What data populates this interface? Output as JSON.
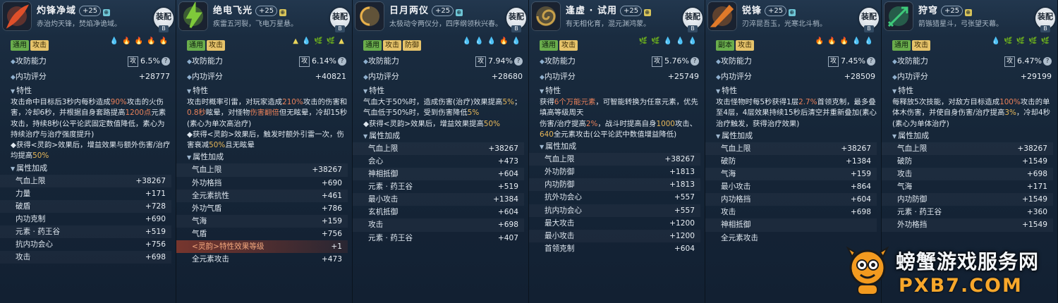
{
  "labels": {
    "equip": "装配",
    "equip_badge": "B",
    "attack_power": "攻防能力",
    "attack_box": "攻",
    "help": "?",
    "inner_score": "内功评分",
    "traits": "特性",
    "attr_bonus": "属性加成"
  },
  "cards": [
    {
      "name": "灼锋净域",
      "level": "+25",
      "gem": "⊕",
      "subtitle": "赤治灼天锋，焚焰净诡域。",
      "icon": "flame-slash-icon",
      "icon_color": "#e0502a",
      "tags": [
        "通用",
        "攻击"
      ],
      "tag_colors": [
        "green",
        "yellow"
      ],
      "elements": [
        "💧",
        "🔥",
        "🔥",
        "🔥",
        "🔥"
      ],
      "element_colors": [
        "#6fb3ff",
        "#ff6a3d",
        "#ff6a3d",
        "#ff6a3d",
        "#ff6a3d"
      ],
      "power": "6.5%",
      "score": "+28777",
      "desc": [
        {
          "t": "攻击命中目标后3秒内每秒造成"
        },
        {
          "t": "90%",
          "c": "r"
        },
        {
          "t": "攻击的火伤害，冷却6秒，并根据自身套路提高"
        },
        {
          "t": "1200点",
          "c": "r"
        },
        {
          "t": "元素攻击，持续8秒(公平论武固定数值降低，素心为持续治疗与治疗强度提升)"
        },
        {
          "t": "\n◆获得<灵韵>效果后，增益效果与额外伤害/治疗均提高"
        },
        {
          "t": "50%",
          "c": "y"
        }
      ],
      "attrs": [
        [
          "气血上限",
          "+38267"
        ],
        [
          "力量",
          "+171"
        ],
        [
          "破盾",
          "+728"
        ],
        [
          "内功克制",
          "+690"
        ],
        [
          "元素 · 药王谷",
          "+519"
        ],
        [
          "抗内功会心",
          "+756"
        ],
        [
          "攻击",
          "+698"
        ]
      ]
    },
    {
      "name": "绝电飞光",
      "level": "+25",
      "gem": "⊕",
      "subtitle": "疾雷五河裂，飞电万星悬。",
      "icon": "lightning-icon",
      "icon_color": "#7fc93a",
      "tags": [
        "通用",
        "攻击"
      ],
      "tag_colors": [
        "green",
        "yellow"
      ],
      "elements": [
        "▲",
        "💧",
        "🌿",
        "🌿",
        "▲"
      ],
      "element_colors": [
        "#e8d45a",
        "#7fd08a",
        "#7fd08a",
        "#7fd08a",
        "#e8d45a"
      ],
      "power": "6.14%",
      "score": "+40821",
      "desc": [
        {
          "t": "攻击时概率引雷，对玩家造成"
        },
        {
          "t": "210%",
          "c": "r"
        },
        {
          "t": "攻击的伤害和"
        },
        {
          "t": "0.8秒",
          "c": "r"
        },
        {
          "t": "眩晕，对怪物"
        },
        {
          "t": "伤害翻倍",
          "c": "r"
        },
        {
          "t": "但无眩晕，冷却15秒(素心为单次高治疗)"
        },
        {
          "t": "\n◆获得<灵韵>效果后，触发时额外引雷一次，伤害衰减"
        },
        {
          "t": "50%",
          "c": "y"
        },
        {
          "t": "且无眩晕"
        }
      ],
      "attrs": [
        [
          "气血上限",
          "+38267"
        ],
        [
          "外功格挡",
          "+690"
        ],
        [
          "全元素抗性",
          "+461"
        ],
        [
          "外功气盾",
          "+786"
        ],
        [
          "气海",
          "+159"
        ],
        [
          "气盾",
          "+756"
        ],
        [
          "<灵韵>特性效果等级",
          "+1"
        ],
        [
          "全元素攻击",
          "+473"
        ]
      ],
      "special_index": 6
    },
    {
      "name": "日月两仪",
      "level": "+25",
      "gem": "⊕",
      "subtitle": "太极动令两仪分，四序纲领秋兴春。",
      "icon": "sun-moon-icon",
      "icon_color": "#e8b04a",
      "tags": [
        "通用",
        "攻击",
        "防御"
      ],
      "tag_colors": [
        "green",
        "yellow",
        "yellow"
      ],
      "elements": [
        "💧",
        "💧",
        "💧",
        "🔥",
        "💧"
      ],
      "element_colors": [
        "#7fd08a",
        "#6fb3ff",
        "#6fb3ff",
        "#ff6a3d",
        "#7fd08a"
      ],
      "power": "7.94%",
      "score": "+28680",
      "desc": [
        {
          "t": "气血大于50%时，造成伤害(治疗)效果提高"
        },
        {
          "t": "5%",
          "c": "y"
        },
        {
          "t": "；气血低于50%时，受到伤害降低"
        },
        {
          "t": "5%",
          "c": "y"
        },
        {
          "t": "\n◆获得<灵韵>效果后，增益效果提高"
        },
        {
          "t": "50%",
          "c": "y"
        }
      ],
      "attrs": [
        [
          "气血上限",
          "+38267"
        ],
        [
          "会心",
          "+473"
        ],
        [
          "神相抵御",
          "+604"
        ],
        [
          "元素 · 药王谷",
          "+519"
        ],
        [
          "最小攻击",
          "+1384"
        ],
        [
          "玄机抵御",
          "+604"
        ],
        [
          "攻击",
          "+698"
        ],
        [
          "元素 · 药王谷",
          "+407"
        ]
      ]
    },
    {
      "name": "逢虚 · 试用",
      "level": "+25",
      "gem": "⊕",
      "subtitle": "有无相化育，混元渊鸿蒙。",
      "icon": "swirl-icon",
      "icon_color": "#c8a04a",
      "tags": [
        "通用",
        "攻击"
      ],
      "tag_colors": [
        "green",
        "yellow"
      ],
      "elements": [
        "🌿",
        "🌿",
        "💧",
        "💧",
        "💧"
      ],
      "element_colors": [
        "#7fd08a",
        "#7fd08a",
        "#6fb3ff",
        "#c8d8e8",
        "#6fb3ff"
      ],
      "power": "5.76%",
      "score": "+25749",
      "desc": [
        {
          "t": "获得"
        },
        {
          "t": "6个万能元素",
          "c": "r"
        },
        {
          "t": "，可智能转换为任意元素，优先填高等级周天"
        },
        {
          "t": "\n伤害/治疗提高"
        },
        {
          "t": "2%",
          "c": "r"
        },
        {
          "t": "，战斗时提高自身"
        },
        {
          "t": "1000",
          "c": "y"
        },
        {
          "t": "攻击、"
        },
        {
          "t": "640",
          "c": "y"
        },
        {
          "t": "全元素攻击(公平论武中数值增益降低)"
        }
      ],
      "attrs": [
        [
          "气血上限",
          "+38267"
        ],
        [
          "外功防御",
          "+1813"
        ],
        [
          "内功防御",
          "+1813"
        ],
        [
          "抗外功会心",
          "+557"
        ],
        [
          "抗内功会心",
          "+557"
        ],
        [
          "最大攻击",
          "+1200"
        ],
        [
          "最小攻击",
          "+1200"
        ],
        [
          "首领克制",
          "+604"
        ]
      ]
    },
    {
      "name": "锐锋",
      "level": "+25",
      "gem": "⊕",
      "subtitle": "刃淬昆吾玉，光寒北斗梢。",
      "icon": "blade-icon",
      "icon_color": "#e07a2a",
      "tags": [
        "副本",
        "攻击"
      ],
      "tag_colors": [
        "green",
        "yellow"
      ],
      "elements": [
        "🔥",
        "🔥",
        "🔥",
        "💧",
        "💧"
      ],
      "element_colors": [
        "#ff6a3d",
        "#ff6a3d",
        "#ff6a3d",
        "#6fb3ff",
        "#6fb3ff"
      ],
      "power": "7.45%",
      "score": "+28509",
      "desc": [
        {
          "t": "攻击怪物时每5秒获得1层"
        },
        {
          "t": "2.7%",
          "c": "r"
        },
        {
          "t": "首领克制，最多叠至4层，4层效果持续15秒后清空并重新叠加(素心治疗触发，获得治疗效果)"
        }
      ],
      "attrs": [
        [
          "气血上限",
          "+38267"
        ],
        [
          "破防",
          "+1384"
        ],
        [
          "气海",
          "+159"
        ],
        [
          "最小攻击",
          "+864"
        ],
        [
          "内功格挡",
          "+604"
        ],
        [
          "攻击",
          "+698"
        ],
        [
          "神相抵御",
          ""
        ],
        [
          "全元素攻击",
          ""
        ]
      ]
    },
    {
      "name": "狩穹",
      "level": "+25",
      "gem": "⊕",
      "subtitle": "箭镞猎星斗，弓张望天幕。",
      "icon": "arrow-icon",
      "icon_color": "#3ec97a",
      "tags": [
        "通用",
        "攻击"
      ],
      "tag_colors": [
        "green",
        "yellow"
      ],
      "elements": [
        "💧",
        "🌿",
        "🌿",
        "🌿",
        "🌿"
      ],
      "element_colors": [
        "#7fd08a",
        "#7fd08a",
        "#7fd08a",
        "#7fd08a",
        "#7fd08a"
      ],
      "power": "6.47%",
      "score": "+29199",
      "desc": [
        {
          "t": "每释放5次技能，对敌方目标造成"
        },
        {
          "t": "100%",
          "c": "r"
        },
        {
          "t": "攻击的单体木伤害，并使自身伤害/治疗提高"
        },
        {
          "t": "3%",
          "c": "y"
        },
        {
          "t": "，冷却4秒(素心为单体治疗)"
        }
      ],
      "attrs": [
        [
          "气血上限",
          "+38267"
        ],
        [
          "破防",
          "+1549"
        ],
        [
          "攻击",
          "+698"
        ],
        [
          "气海",
          "+171"
        ],
        [
          "内功防御",
          "+1549"
        ],
        [
          "元素 · 药王谷",
          "+360"
        ],
        [
          "外功格挡",
          "+1549"
        ]
      ]
    }
  ],
  "watermark": {
    "site_name": "螃蟹游戏服务网",
    "url": "PXB7.COM",
    "logo": "crab-mascot-icon"
  }
}
